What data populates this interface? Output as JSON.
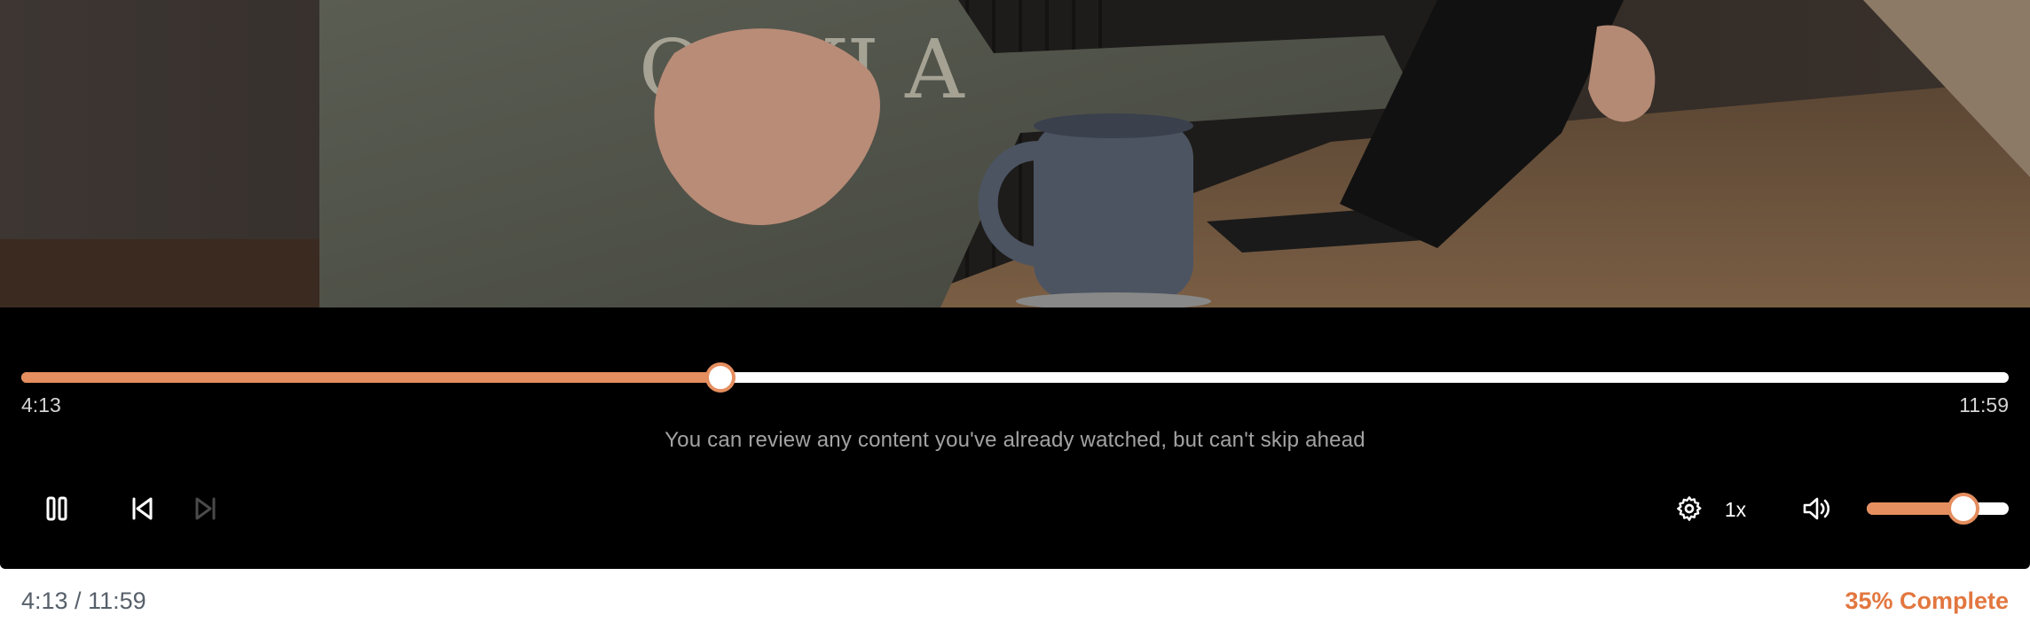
{
  "player": {
    "video": {
      "description_icon": "video-frame"
    },
    "seek": {
      "progress_fraction": 0.352,
      "current_time": "4:13",
      "total_time": "11:59"
    },
    "notice": "You can review any content you've already watched, but can't skip ahead",
    "controls": {
      "pause_icon": "pause-icon",
      "previous_icon": "skip-back-icon",
      "next_icon": "skip-forward-icon",
      "next_disabled": true,
      "settings_icon": "gear-icon",
      "speed_label": "1x",
      "volume_icon": "volume-icon",
      "volume_fraction": 0.68
    },
    "colors": {
      "accent": "#e58e5f",
      "track": "#ffffff",
      "background": "#000000"
    }
  },
  "footer": {
    "time_text": "4:13 / 11:59",
    "progress_text": "35% Complete",
    "progress_color": "#e2773f"
  }
}
